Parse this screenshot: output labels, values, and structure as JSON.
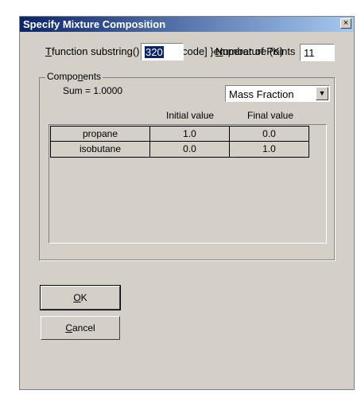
{
  "window": {
    "title": "Specify Mixture Composition",
    "close_glyph": "×"
  },
  "temperature": {
    "label": "Temperature (K)",
    "value": "320"
  },
  "num_points": {
    "label": "Number of Points",
    "value": "11"
  },
  "components": {
    "group_label": "Components",
    "sum_text": "Sum = 1.0000",
    "fraction_type": "Mass Fraction",
    "columns": {
      "initial": "Initial value",
      "final": "Final value"
    },
    "rows": [
      {
        "name": "propane",
        "initial": "1.0",
        "final": "0.0"
      },
      {
        "name": "isobutane",
        "initial": "0.0",
        "final": "1.0"
      }
    ]
  },
  "buttons": {
    "ok": "OK",
    "cancel": "Cancel"
  }
}
